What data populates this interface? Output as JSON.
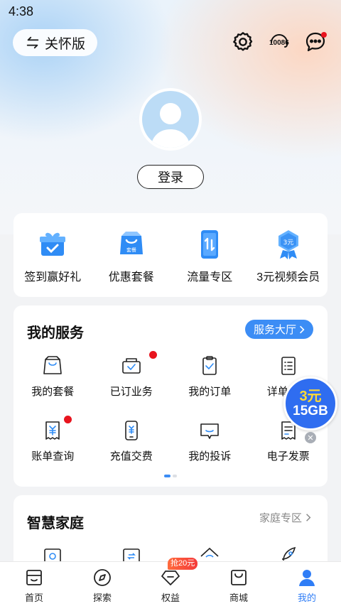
{
  "status_bar": {
    "time": "4:38"
  },
  "header": {
    "care_mode_label": "关怀版",
    "hotline_badge": "10086",
    "icons": [
      "settings-icon",
      "customer-service-icon",
      "message-icon"
    ]
  },
  "profile": {
    "login_label": "登录"
  },
  "quick_actions": [
    {
      "label": "签到赢好礼",
      "icon": "gift-icon"
    },
    {
      "label": "优惠套餐",
      "icon": "package-bag-icon",
      "icon_text": "套餐"
    },
    {
      "label": "流量专区",
      "icon": "data-phone-icon"
    },
    {
      "label": "3元视频会员",
      "icon": "vip-badge-icon",
      "icon_text": "3元"
    }
  ],
  "services": {
    "title": "我的服务",
    "hall_button": "服务大厅",
    "rows": [
      [
        {
          "label": "我的套餐",
          "icon": "bag-icon",
          "dot": false
        },
        {
          "label": "已订业务",
          "icon": "subscribed-icon",
          "dot": true
        },
        {
          "label": "我的订单",
          "icon": "clipboard-check-icon",
          "dot": false
        },
        {
          "label": "详单查询",
          "icon": "list-doc-icon",
          "dot": false
        }
      ],
      [
        {
          "label": "账单查询",
          "icon": "bill-yen-icon",
          "dot": true
        },
        {
          "label": "充值交费",
          "icon": "phone-yen-icon",
          "dot": false
        },
        {
          "label": "我的投诉",
          "icon": "complaint-chat-icon",
          "dot": false
        },
        {
          "label": "电子发票",
          "icon": "invoice-icon",
          "dot": false
        }
      ]
    ],
    "page_indicator": {
      "pages": 2,
      "current": 1
    }
  },
  "promo_float": {
    "line1": "3元",
    "line2": "15GB"
  },
  "family": {
    "title": "智慧家庭",
    "link_label": "家庭专区",
    "icons": [
      "clock-device-icon",
      "refresh-device-icon",
      "wifi-home-icon",
      "rocket-icon"
    ]
  },
  "tabbar": {
    "tabs": [
      {
        "label": "首页",
        "icon": "home-icon",
        "active": false
      },
      {
        "label": "探索",
        "icon": "compass-icon",
        "active": false
      },
      {
        "label": "权益",
        "icon": "diamond-icon",
        "active": false
      },
      {
        "label": "商城",
        "icon": "shopping-bag-icon",
        "active": false
      },
      {
        "label": "我的",
        "icon": "profile-icon",
        "active": true
      }
    ],
    "rights_badge": "抢20元"
  },
  "colors": {
    "accent": "#3c8df5",
    "active_tab": "#2f7df6",
    "dot_red": "#e8141e",
    "icon_blue": "#2f8cf5"
  }
}
